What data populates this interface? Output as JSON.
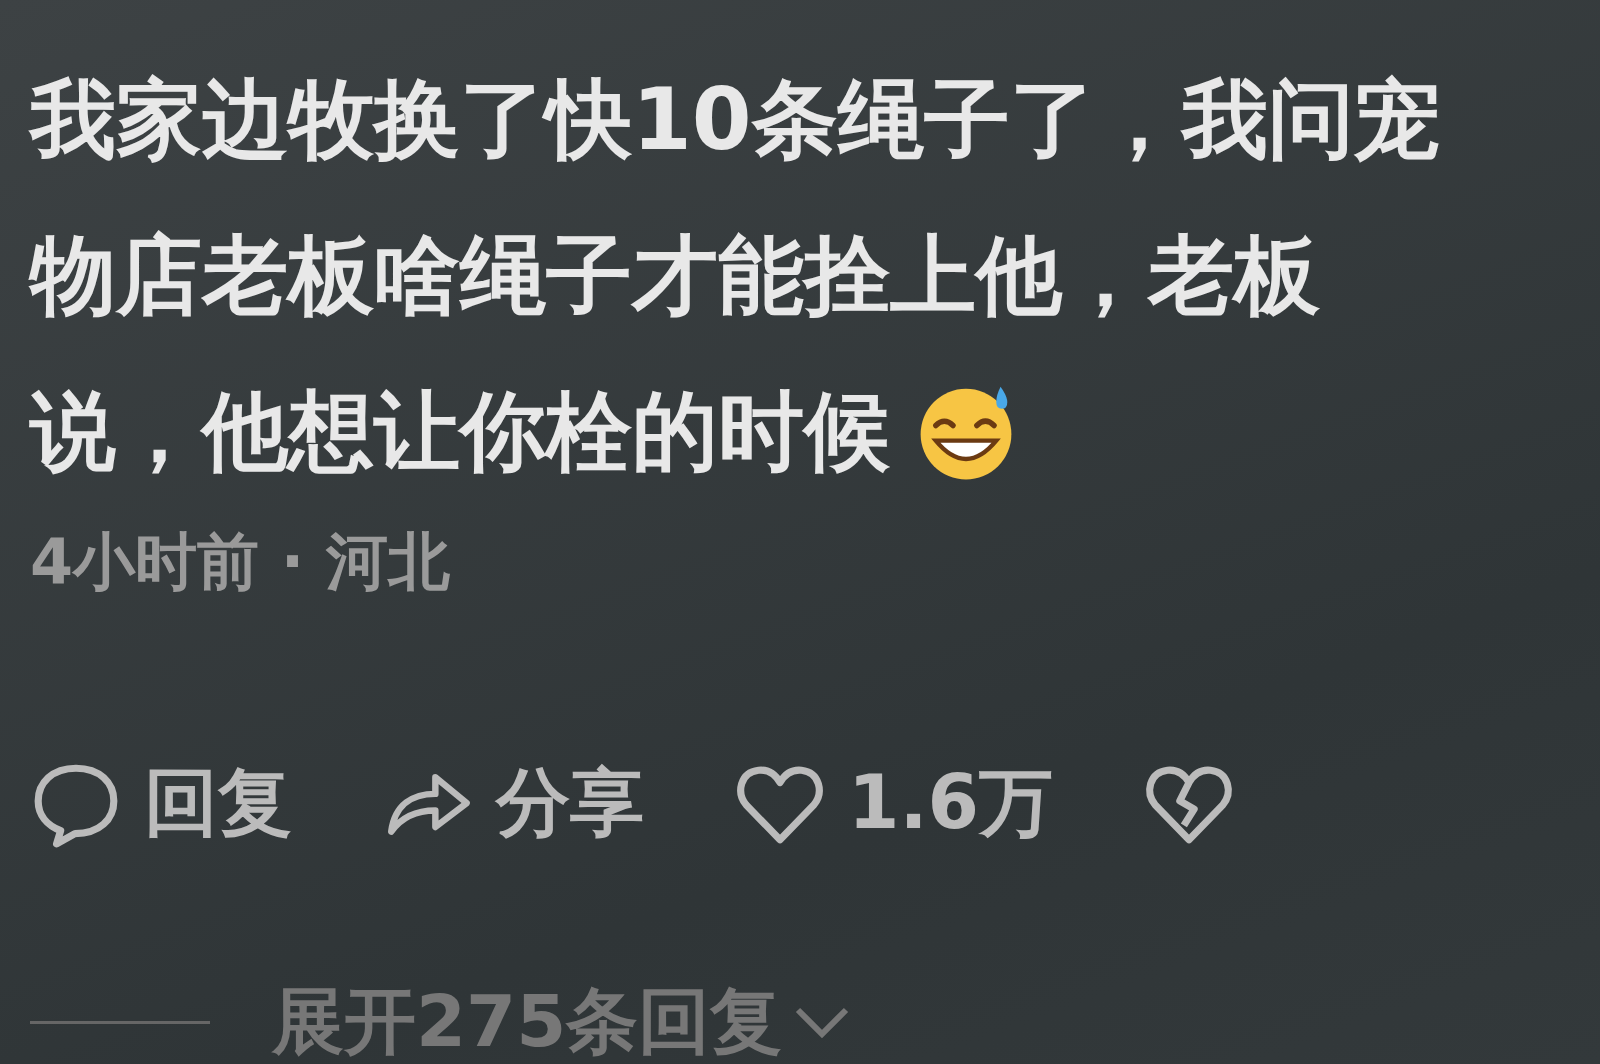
{
  "comment": {
    "lines": [
      "我家边牧换了快10条绳子了，我问宠",
      "物店老板啥绳子才能拴上他，老板",
      "说，他想让你栓的时候"
    ],
    "meta": "4小时前 · 河北"
  },
  "actions": [
    {
      "kind": "reply",
      "label": "回复"
    },
    {
      "kind": "share",
      "label": "分享"
    },
    {
      "kind": "like",
      "label": "1.6万"
    },
    {
      "kind": "dislike"
    }
  ],
  "expand": {
    "label": "展开275条回复"
  }
}
